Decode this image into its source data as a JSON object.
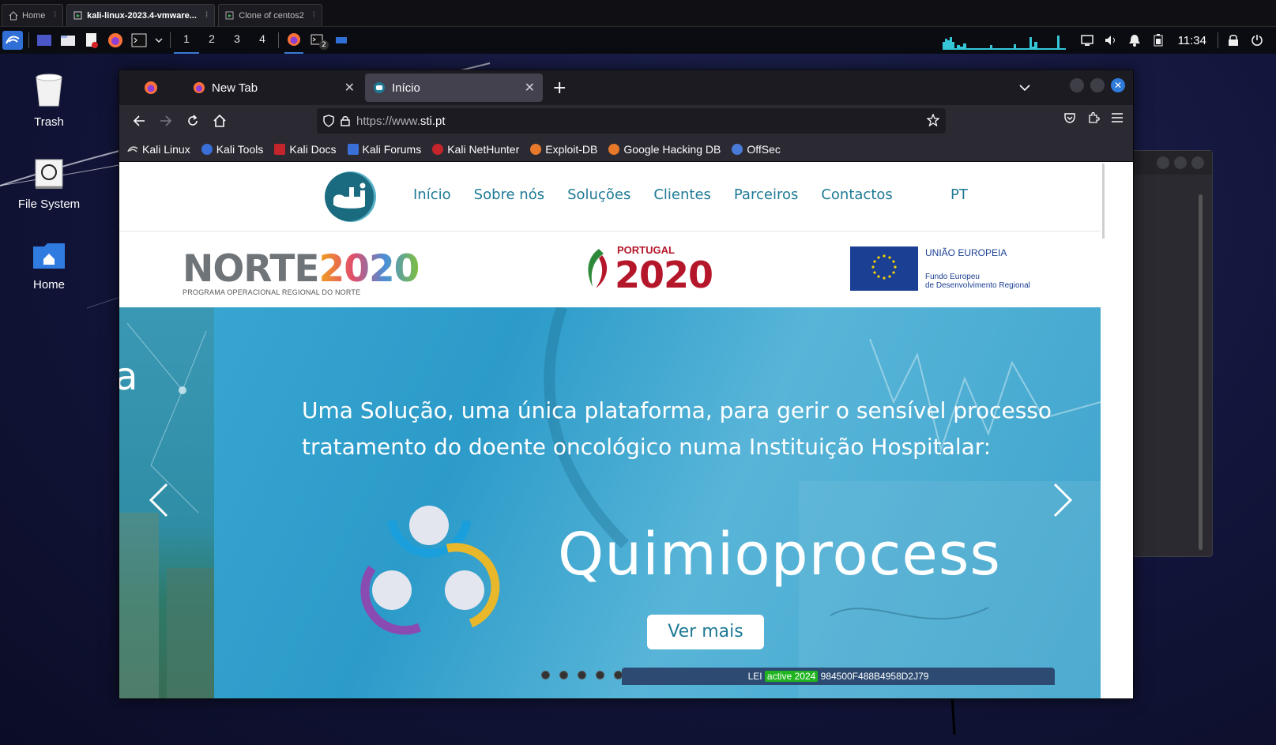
{
  "vm_tabs": [
    {
      "label": "Home",
      "active": false
    },
    {
      "label": "kali-linux-2023.4-vmware...",
      "active": true
    },
    {
      "label": "Clone of centos2",
      "active": false
    }
  ],
  "panel": {
    "workspaces": [
      "1",
      "2",
      "3",
      "4"
    ],
    "terminal_badge": "2",
    "clock": "11:34"
  },
  "desktop": {
    "icons": [
      {
        "label": "Trash",
        "icon": "trash-icon"
      },
      {
        "label": "File System",
        "icon": "drive-icon"
      },
      {
        "label": "Home",
        "icon": "home-folder-icon"
      }
    ]
  },
  "browser": {
    "tabs": [
      {
        "label": "New Tab",
        "active": false
      },
      {
        "label": "Início",
        "active": true
      }
    ],
    "url_prefix": "https://www.",
    "url_domain": "sti.pt",
    "bookmarks": [
      {
        "label": "Kali Linux",
        "color": "#2b2a33"
      },
      {
        "label": "Kali Tools",
        "color": "#3a6fd8"
      },
      {
        "label": "Kali Docs",
        "color": "#c4252a"
      },
      {
        "label": "Kali Forums",
        "color": "#3a6fd8"
      },
      {
        "label": "Kali NetHunter",
        "color": "#c4252a"
      },
      {
        "label": "Exploit-DB",
        "color": "#e8782a"
      },
      {
        "label": "Google Hacking DB",
        "color": "#e8782a"
      },
      {
        "label": "OffSec",
        "color": "#4a7ad8"
      }
    ]
  },
  "site": {
    "menu": [
      "Início",
      "Sobre nós",
      "Soluções",
      "Clientes",
      "Parceiros",
      "Contactos"
    ],
    "lang": "PT",
    "sponsors": {
      "norte_a": "NORTE",
      "norte_b": "2020",
      "norte_sub": "PROGRAMA OPERACIONAL REGIONAL DO NORTE",
      "pt_label": "PORTUGAL",
      "pt_year": "2020",
      "eu_title": "UNIÃO EUROPEIA",
      "eu_sub_1": "Fundo Europeu",
      "eu_sub_2": "de Desenvolvimento Regional"
    },
    "hero": {
      "left_letter": "a",
      "line1": "Uma Solução, uma única plataforma, para gerir o sensível processo",
      "line2": "tratamento do doente oncológico numa Instituição Hospitalar:",
      "title": "Quimioprocess",
      "button": "Ver mais",
      "slides": 5
    },
    "lei": {
      "prefix": "LEI",
      "badge": "active 2024",
      "code": "984500F488B4958D2J79"
    }
  },
  "colors": {
    "accent": "#1f7a95",
    "firefox_bg": "#1c1b22",
    "toolbar": "#2b2a33"
  }
}
